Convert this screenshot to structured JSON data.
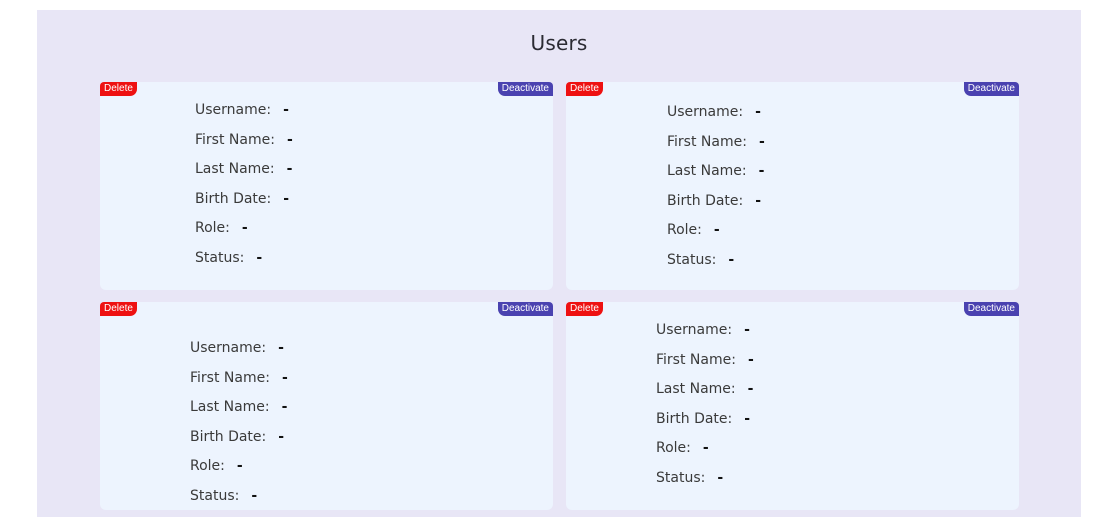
{
  "page": {
    "title": "Users"
  },
  "card_buttons": {
    "delete_label": "Delete",
    "deactivate_label": "Deactivate"
  },
  "field_labels": {
    "username": "Username:",
    "first_name": "First Name:",
    "last_name": "Last Name:",
    "birth_date": "Birth Date:",
    "role": "Role:",
    "status": "Status:"
  },
  "users": [
    {
      "username": "-",
      "first_name": "-",
      "last_name": "-",
      "birth_date": "-",
      "role": "-",
      "status": "-"
    },
    {
      "username": "-",
      "first_name": "-",
      "last_name": "-",
      "birth_date": "-",
      "role": "-",
      "status": "-"
    },
    {
      "username": "-",
      "first_name": "-",
      "last_name": "-",
      "birth_date": "-",
      "role": "-",
      "status": "-"
    },
    {
      "username": "-",
      "first_name": "-",
      "last_name": "-",
      "birth_date": "-",
      "role": "-",
      "status": "-"
    }
  ],
  "colors": {
    "page_background": "#e8e6f6",
    "card_background": "#edf4fe",
    "delete_button": "#ee1111",
    "deactivate_button": "#4a42b0"
  }
}
